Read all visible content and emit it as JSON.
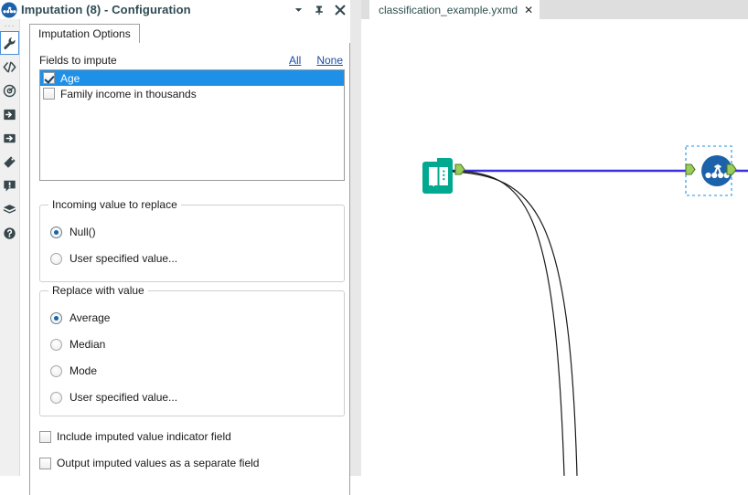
{
  "config_panel": {
    "title": "Imputation (8) - Configuration",
    "title_icon": "imputation-node-icon",
    "titlebar_buttons": [
      {
        "name": "chevron-down-icon",
        "glyph": "▼"
      },
      {
        "name": "pin-icon",
        "glyph": "⚐"
      },
      {
        "name": "close-icon",
        "glyph": "✕"
      }
    ],
    "icon_rail": {
      "overflow_dots": "···",
      "items": [
        {
          "name": "wrench-icon",
          "selected": true
        },
        {
          "name": "code-icon",
          "selected": false
        },
        {
          "name": "target-icon",
          "selected": false
        },
        {
          "name": "input-arrow-icon",
          "selected": false
        },
        {
          "name": "output-arrow-icon",
          "selected": false
        },
        {
          "name": "tag-icon",
          "selected": false
        },
        {
          "name": "warning-comment-icon",
          "selected": false
        },
        {
          "name": "package-icon",
          "selected": false
        },
        {
          "name": "help-icon",
          "selected": false
        }
      ]
    },
    "tabs": [
      {
        "label": "Imputation Options",
        "active": true
      }
    ],
    "fields_section": {
      "label": "Fields to impute",
      "links": {
        "all": "All",
        "none": "None"
      },
      "items": [
        {
          "label": "Age",
          "checked": true,
          "selected": true
        },
        {
          "label": "Family income in thousands",
          "checked": false,
          "selected": false
        }
      ]
    },
    "incoming_group": {
      "legend": "Incoming value to replace",
      "options": [
        {
          "label": "Null()",
          "selected": true
        },
        {
          "label": "User specified value...",
          "selected": false
        }
      ]
    },
    "replace_group": {
      "legend": "Replace with value",
      "options": [
        {
          "label": "Average",
          "selected": true
        },
        {
          "label": "Median",
          "selected": false
        },
        {
          "label": "Mode",
          "selected": false
        },
        {
          "label": "User specified value...",
          "selected": false
        }
      ]
    },
    "bottom_checkboxes": [
      {
        "label": "Include imputed value indicator field",
        "checked": false
      },
      {
        "label": "Output imputed values as a separate field",
        "checked": false
      }
    ]
  },
  "canvas": {
    "document_tab": {
      "label": "classification_example.yxmd",
      "close": "✕"
    },
    "nodes": [
      {
        "name": "input-data-node",
        "icon": "book-icon",
        "selected": false
      },
      {
        "name": "imputation-node",
        "icon": "imputation-node-icon",
        "selected": true
      }
    ]
  },
  "colors": {
    "accent_blue": "#1e90e8",
    "link_blue": "#1b4ea8",
    "title_text": "#2e4a52",
    "input_node_teal": "#00a98f",
    "imputation_node_blue": "#1b62ab",
    "connector_green": "#9acd5c",
    "connection_line": "#3b2fe0",
    "canvas_tabstrip": "#dedede",
    "rail_bg": "#f0f0f0"
  }
}
